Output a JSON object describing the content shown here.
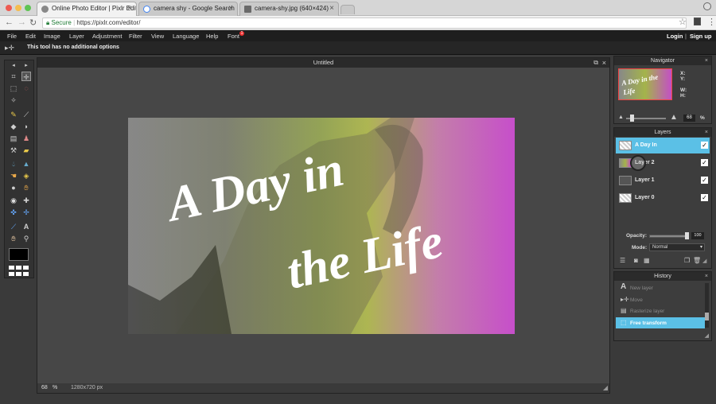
{
  "browser": {
    "tabs": [
      {
        "label": "Online Photo Editor | Pixlr Edit"
      },
      {
        "label": "camera shy - Google Search"
      },
      {
        "label": "camera-shy.jpg (640×424)"
      }
    ],
    "address": {
      "secure_label": "Secure",
      "url": "https://pixlr.com/editor/"
    }
  },
  "menu": {
    "items": [
      "File",
      "Edit",
      "Image",
      "Layer",
      "Adjustment",
      "Filter",
      "View",
      "Language",
      "Help",
      "Font"
    ],
    "font_badge": "1",
    "login": "Login",
    "separator": "|",
    "signup": "Sign up"
  },
  "options_bar": {
    "text": "This tool has no additional options"
  },
  "workspace": {
    "title": "Untitled",
    "zoom": "68",
    "zoom_unit": "%",
    "dimensions": "1280x720 px"
  },
  "canvas": {
    "line1": "A Day in",
    "line2": "the Life"
  },
  "navigator": {
    "title": "Navigator",
    "thumb_text": "A Day in the Life",
    "labels": {
      "x": "X:",
      "y": "Y:",
      "w": "W:",
      "h": "H:"
    },
    "zoom_value": "68",
    "zoom_unit": "%"
  },
  "layers": {
    "title": "Layers",
    "items": [
      {
        "name": "A Day In"
      },
      {
        "name": "Layer 2"
      },
      {
        "name": "Layer 1"
      },
      {
        "name": "Layer 0"
      }
    ],
    "opacity_label": "Opacity:",
    "opacity_value": "100",
    "mode_label": "Mode:",
    "mode_value": "Normal"
  },
  "history": {
    "title": "History",
    "items": [
      {
        "label": "New layer"
      },
      {
        "label": "Move"
      },
      {
        "label": "Rasterize layer"
      },
      {
        "label": "Free transform"
      }
    ]
  },
  "colors": {
    "accent": "#5bc0e6",
    "bg": "#3a3a3a"
  }
}
